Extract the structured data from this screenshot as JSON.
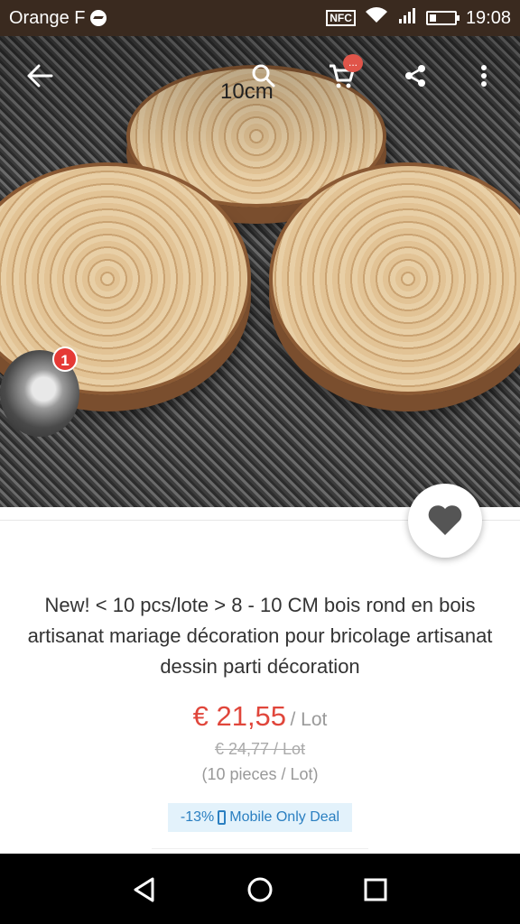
{
  "status_bar": {
    "carrier": "Orange F",
    "nfc": "NFC",
    "time": "19:08"
  },
  "hero": {
    "image_label": "10cm",
    "cart_badge": "...",
    "avatar_badge": "1"
  },
  "product": {
    "title": "New! < 10 pcs/lote > 8 - 10 CM bois rond en bois artisanat mariage décoration pour bricolage artisanat dessin parti décoration",
    "price": "€ 21,55",
    "unit": "/ Lot",
    "old_price": "€ 24,77 / Lot",
    "pieces": "(10 pieces / Lot)",
    "deal_percent": "-13%",
    "deal_label": "Mobile Only Deal"
  },
  "colors": {
    "price": "#e0463b",
    "deal_text": "#2a7fc1",
    "deal_bg": "#e3f2fb",
    "badge": "#e53935"
  },
  "icons": [
    "back-icon",
    "search-icon",
    "cart-icon",
    "share-icon",
    "more-icon",
    "heart-icon",
    "nav-back-icon",
    "nav-home-icon",
    "nav-recents-icon"
  ]
}
